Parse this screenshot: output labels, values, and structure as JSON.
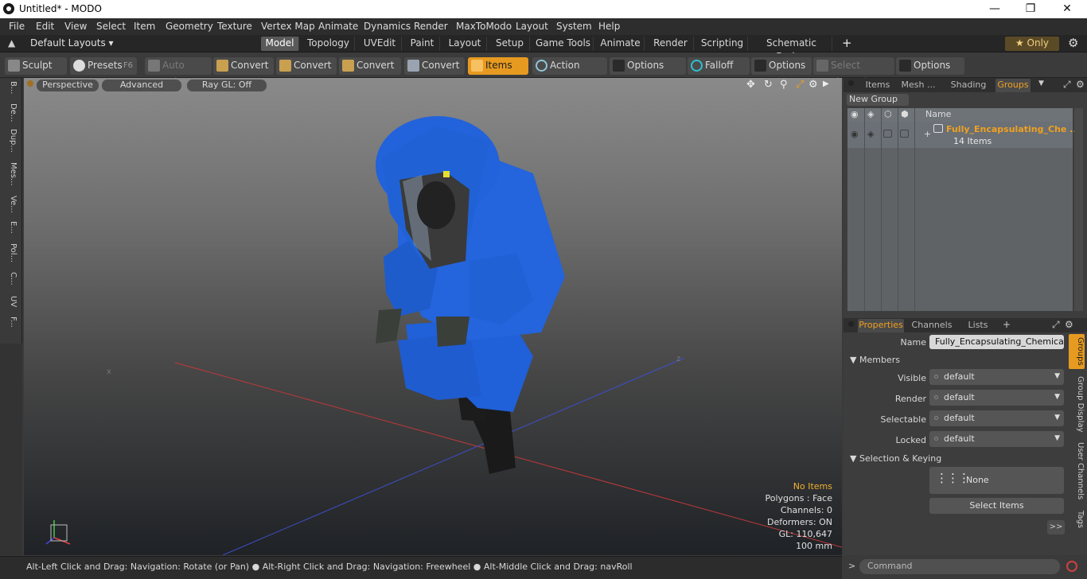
{
  "window": {
    "title": "Untitled* - MODO",
    "minimize": "—",
    "restore": "❐",
    "close": "✕"
  },
  "menu": [
    "File",
    "Edit",
    "View",
    "Select",
    "Item",
    "Geometry",
    "Texture",
    "Vertex Map",
    "Animate",
    "Dynamics",
    "Render",
    "MaxToModo",
    "Layout",
    "System",
    "Help"
  ],
  "layouts": {
    "default_label": "Default Layouts ▾",
    "tabs": [
      "Model",
      "Topology",
      "UVEdit",
      "Paint",
      "Layout",
      "Setup",
      "Game Tools",
      "Animate",
      "Render",
      "Scripting",
      "Schematic Fusion"
    ],
    "active": "Model",
    "add": "+",
    "only": "★ Only"
  },
  "toolbar": {
    "sculpt": "Sculpt",
    "presets": "Presets",
    "presets_key": "F6",
    "auto_select": "Auto Select",
    "convert1": "Convert",
    "convert2": "Convert",
    "convert3": "Convert",
    "convert4": "Convert",
    "items": "Items",
    "action_center": "Action Center",
    "options1": "Options",
    "falloff": "Falloff",
    "options2": "Options",
    "select_through": "Select Through",
    "options3": "Options"
  },
  "left_strip": [
    "B...",
    "De...",
    "Dup...",
    "Mes...",
    "Ve...",
    "E...",
    "Pol...",
    "C...",
    "UV",
    "F..."
  ],
  "viewport": {
    "perspective": "Perspective",
    "advanced": "Advanced",
    "raygl": "Ray GL: Off",
    "info": {
      "no_items": "No Items",
      "polygons": "Polygons : Face",
      "channels": "Channels: 0",
      "deformers": "Deformers: ON",
      "gl": "GL: 110,647",
      "scale": "100 mm"
    },
    "axis_x": "x",
    "axis_z": "z"
  },
  "status": {
    "hint": "Alt-Left Click and Drag: Navigation: Rotate (or Pan) ● Alt-Right Click and Drag: Navigation: Freewheel ● Alt-Middle Click and Drag: navRoll"
  },
  "groups_panel": {
    "tabs": [
      "Items",
      "Mesh ...",
      "Shading",
      "Groups"
    ],
    "active": "Groups",
    "new_group": "New Group",
    "col_name": "Name",
    "group_name": "Fully_Encapsulating_Che ...",
    "group_count": "14 Items"
  },
  "properties": {
    "tabs": [
      "Properties",
      "Channels",
      "Lists"
    ],
    "active": "Properties",
    "add": "+",
    "name_label": "Name",
    "name_value": "Fully_Encapsulating_Chemical_Pr",
    "members_header": "Members",
    "visible_label": "Visible",
    "visible_value": "default",
    "render_label": "Render",
    "render_value": "default",
    "selectable_label": "Selectable",
    "selectable_value": "default",
    "locked_label": "Locked",
    "locked_value": "default",
    "selkey_header": "Selection & Keying",
    "none_btn": "None",
    "select_items_btn": "Select Items",
    "more_btn": ">>"
  },
  "side_tabs": [
    "Groups",
    "Group Display",
    "User Channels",
    "Tags"
  ],
  "command": {
    "placeholder": "Command"
  },
  "colors": {
    "accent": "#e69a20",
    "suit_blue": "#1f5fd6",
    "group_name": "#f0a020"
  }
}
